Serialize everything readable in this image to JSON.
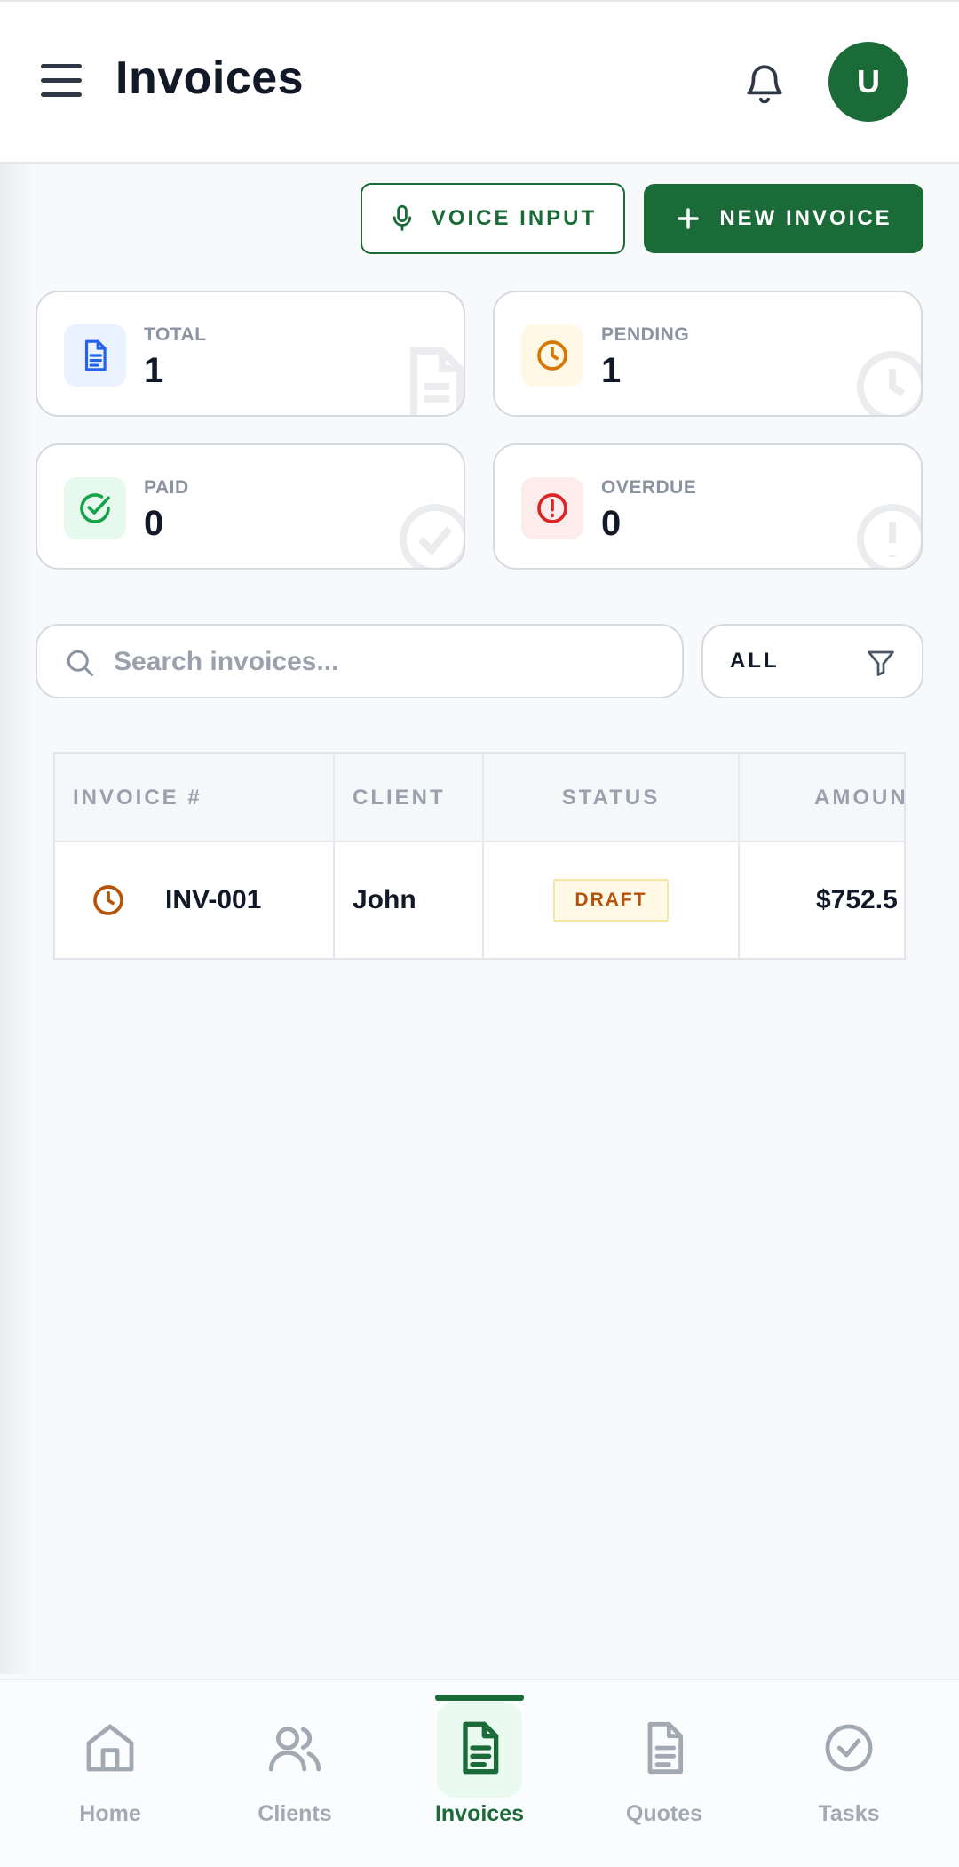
{
  "header": {
    "title": "Invoices",
    "avatar_initial": "U"
  },
  "actions": {
    "voice_label": "VOICE INPUT",
    "new_invoice_label": "NEW INVOICE"
  },
  "stats": [
    {
      "label": "TOTAL",
      "value": "1",
      "color": "#2563eb",
      "bg": "#eaf1ff",
      "icon": "document-icon"
    },
    {
      "label": "PENDING",
      "value": "1",
      "color": "#d97706",
      "bg": "#fff8e6",
      "icon": "clock-icon"
    },
    {
      "label": "PAID",
      "value": "0",
      "color": "#16a34a",
      "bg": "#e7f8ee",
      "icon": "check-circle-icon"
    },
    {
      "label": "OVERDUE",
      "value": "0",
      "color": "#dc2626",
      "bg": "#fdecec",
      "icon": "alert-circle-icon"
    }
  ],
  "search": {
    "placeholder": "Search invoices...",
    "value": ""
  },
  "filter": {
    "selected": "ALL"
  },
  "table": {
    "columns": [
      "INVOICE #",
      "CLIENT",
      "STATUS",
      "AMOUN"
    ],
    "rows": [
      {
        "status_icon": "clock-icon",
        "number": "INV-001",
        "client": "John",
        "status": "DRAFT",
        "amount": "$752.5"
      }
    ]
  },
  "nav": {
    "items": [
      {
        "label": "Home",
        "icon": "home-icon"
      },
      {
        "label": "Clients",
        "icon": "users-icon"
      },
      {
        "label": "Invoices",
        "icon": "document-icon",
        "active": true
      },
      {
        "label": "Quotes",
        "icon": "document-icon"
      },
      {
        "label": "Tasks",
        "icon": "check-circle-icon"
      }
    ]
  },
  "colors": {
    "brand": "#1a6b37",
    "muted": "#9aa1ad",
    "draft_badge_text": "#b45309"
  }
}
